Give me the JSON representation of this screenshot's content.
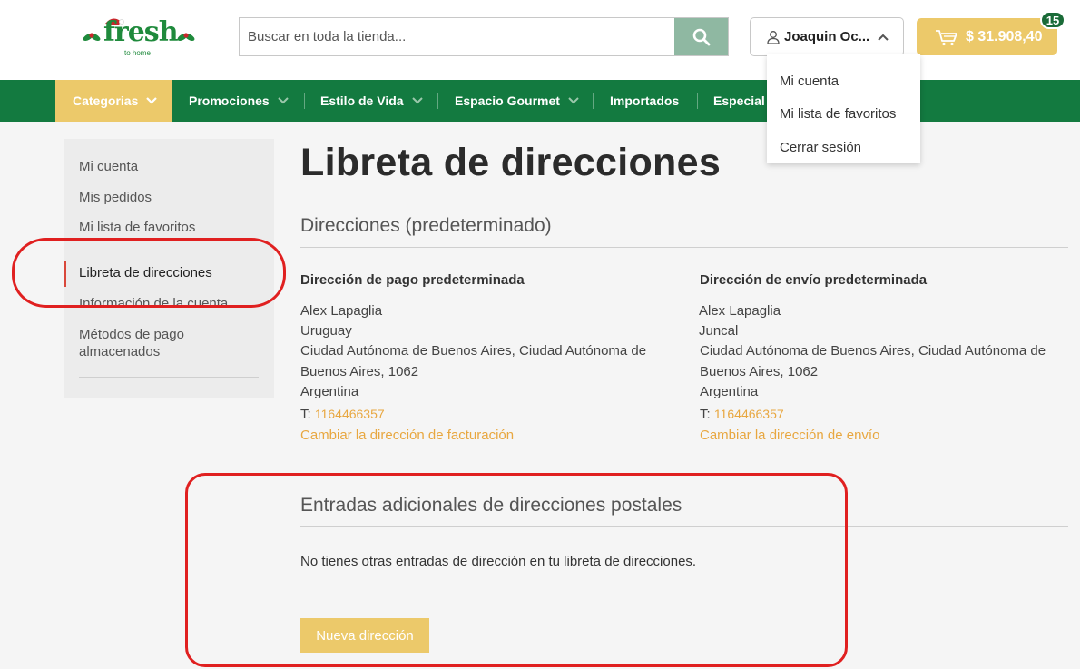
{
  "header": {
    "logo_text": "fresh",
    "logo_subtext": "to home",
    "search_placeholder": "Buscar en toda la tienda...",
    "user_name": "Joaquin Oc...",
    "cart_total": "$ 31.908,40",
    "cart_count": "15"
  },
  "user_menu": {
    "items": [
      "Mi cuenta",
      "Mi lista de favoritos",
      "Cerrar sesión"
    ]
  },
  "nav": {
    "items": [
      "Categorias",
      "Promociones",
      "Estilo de Vida",
      "Espacio Gourmet",
      "Importados",
      "Especial f"
    ]
  },
  "sidebar": {
    "items": [
      "Mi cuenta",
      "Mis pedidos",
      "Mi lista de favoritos"
    ],
    "active": "Libreta de direcciones",
    "after_active": "Información de la cuenta",
    "payment_line1": "Métodos de pago",
    "payment_line2": "almacenados"
  },
  "main": {
    "page_title": "Libreta de direcciones",
    "default_section_title": "Direcciones (predeterminado)",
    "billing": {
      "title": "Dirección de pago predeterminada",
      "name": "Alex Lapaglia",
      "street": "Uruguay",
      "city_line1": "Ciudad Autónoma de Buenos Aires, Ciudad Autónoma de",
      "city_line2": "Buenos Aires, 1062",
      "country": "Argentina",
      "phone_label": "T:",
      "phone": "1164466357",
      "change_link": "Cambiar la dirección de facturación"
    },
    "shipping": {
      "title": "Dirección de envío predeterminada",
      "name": "Alex Lapaglia",
      "street": "Juncal",
      "city_line1": "Ciudad Autónoma de Buenos Aires, Ciudad Autónoma de",
      "city_line2": "Buenos Aires, 1062",
      "country": "Argentina",
      "phone_label": "T:",
      "phone": "1164466357",
      "change_link": "Cambiar la dirección de envío"
    },
    "additional_section_title": "Entradas adicionales de direcciones postales",
    "empty_message": "No tienes otras entradas de dirección en tu libreta de direcciones.",
    "new_address_button": "Nueva dirección"
  },
  "colors": {
    "brand_green": "#137a40",
    "accent_yellow": "#ecc96a",
    "link_orange": "#e8a740",
    "annotation_red": "#e02020"
  }
}
